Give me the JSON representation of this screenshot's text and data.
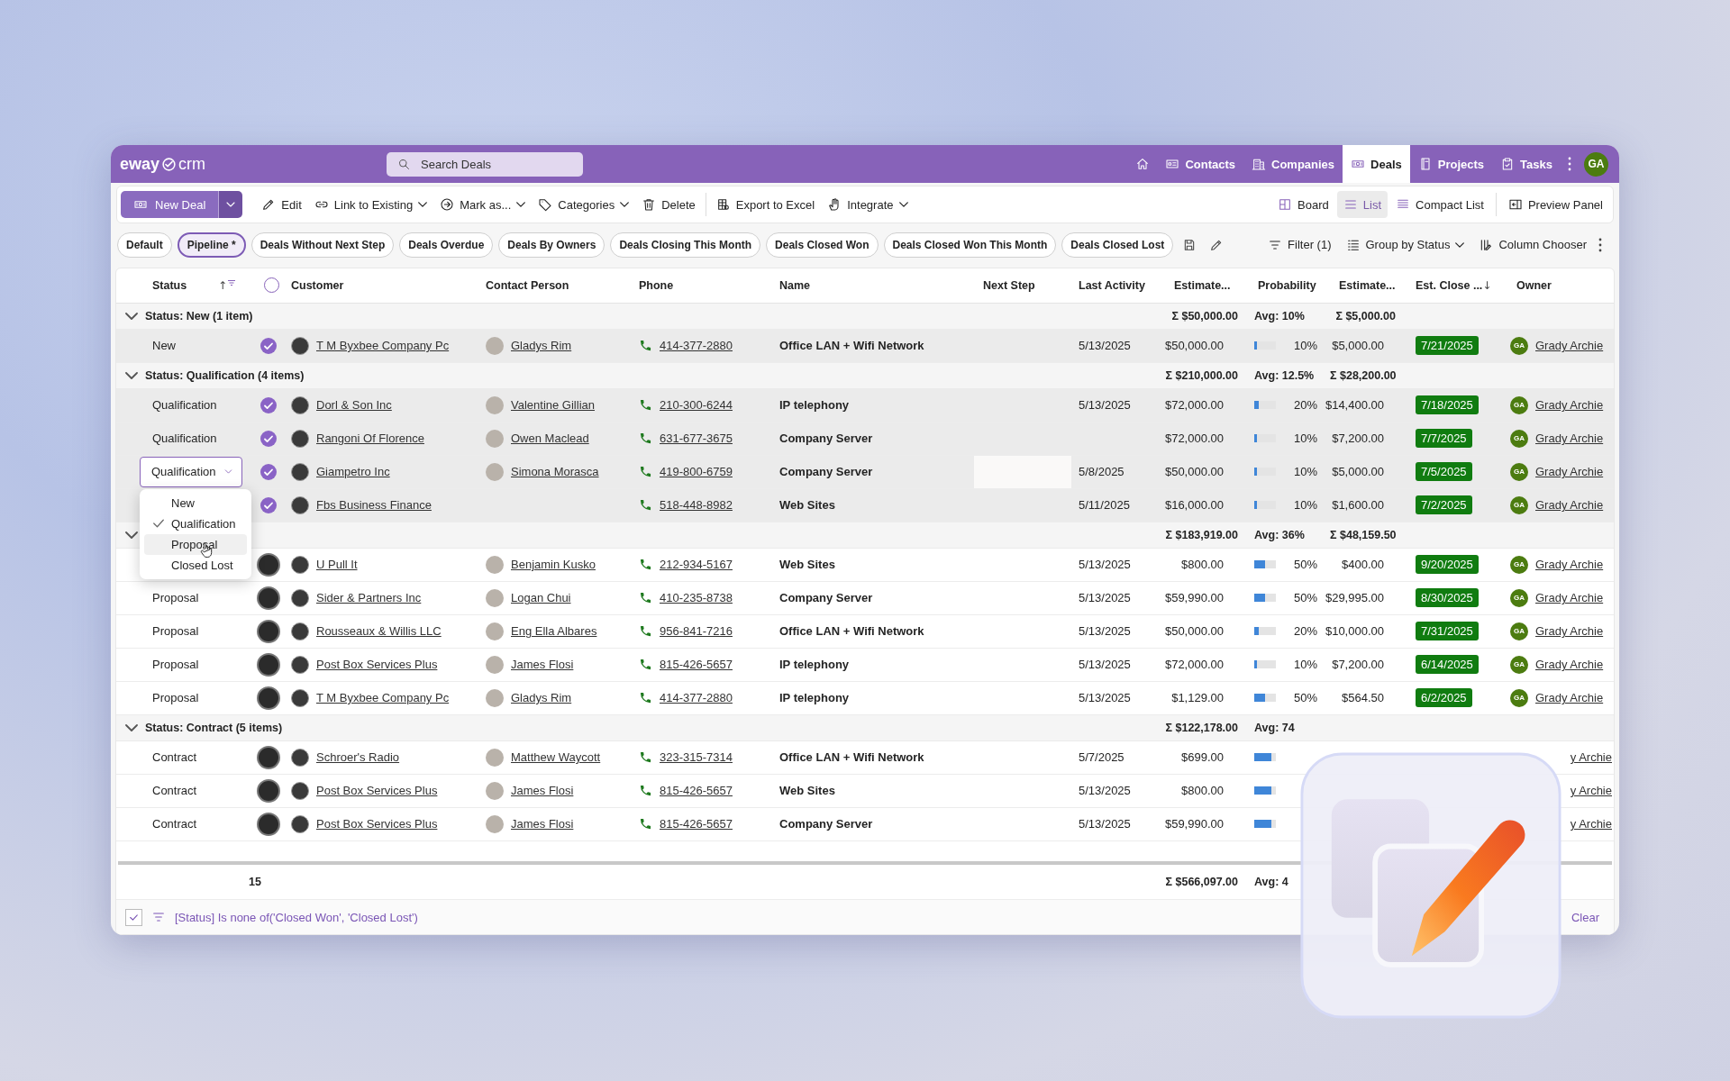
{
  "app_bar": {
    "logo_left": "eway",
    "logo_right": "crm",
    "search": {
      "placeholder": "Search Deals"
    },
    "nav": [
      {
        "label": "Contacts",
        "selected": false
      },
      {
        "label": "Companies",
        "selected": false
      },
      {
        "label": "Deals",
        "selected": true
      },
      {
        "label": "Projects",
        "selected": false
      },
      {
        "label": "Tasks",
        "selected": false
      }
    ],
    "avatar": "GA"
  },
  "toolbar": {
    "primary": "New Deal",
    "actions": [
      {
        "label": "Edit",
        "dropdown": false
      },
      {
        "label": "Link to Existing",
        "dropdown": true
      },
      {
        "label": "Mark as...",
        "dropdown": true
      },
      {
        "label": "Categories",
        "dropdown": true
      },
      {
        "label": "Delete",
        "dropdown": false
      },
      {
        "label": "Export to Excel",
        "dropdown": false
      },
      {
        "label": "Integrate",
        "dropdown": true
      }
    ],
    "views": [
      {
        "label": "Board",
        "selected": false
      },
      {
        "label": "List",
        "selected": true
      },
      {
        "label": "Compact List",
        "selected": false
      }
    ],
    "panel": "Preview Panel"
  },
  "saved_views": {
    "chips": [
      {
        "label": "Default",
        "selected": false
      },
      {
        "label": "Pipeline *",
        "selected": true
      },
      {
        "label": "Deals Without Next Step",
        "selected": false
      },
      {
        "label": "Deals Overdue",
        "selected": false
      },
      {
        "label": "Deals By Owners",
        "selected": false
      },
      {
        "label": "Deals Closing This Month",
        "selected": false
      },
      {
        "label": "Deals Closed Won",
        "selected": false
      },
      {
        "label": "Deals Closed Won This Month",
        "selected": false
      },
      {
        "label": "Deals Closed Lost",
        "selected": false
      }
    ],
    "tools": [
      {
        "label": "Filter (1)",
        "dropdown": false
      },
      {
        "label": "Group by Status",
        "dropdown": true
      },
      {
        "label": "Column Chooser",
        "dropdown": false
      }
    ]
  },
  "table": {
    "columns": [
      {
        "label": "Status",
        "sort_arrow": "↑",
        "filtered": true
      },
      {
        "kind": "select",
        "checked": false
      },
      {
        "label": "Customer"
      },
      {
        "label": "Contact Person"
      },
      {
        "label": "Phone"
      },
      {
        "label": "Name"
      },
      {
        "label": "Next Step"
      },
      {
        "label": "Last Activity"
      },
      {
        "label": "Estimate..."
      },
      {
        "label": "Probability"
      },
      {
        "label": "Estimate..."
      },
      {
        "label": "Est. Close ...",
        "sort_arrow": "↓"
      },
      {
        "label": "Owner"
      }
    ],
    "rows": [
      {
        "kind": "group",
        "expanded": true,
        "label": "Status: New (1 item)",
        "total": "Σ $50,000.00",
        "avg": "Avg: 10%",
        "total_2": "Σ $5,000.00"
      },
      {
        "kind": "deal",
        "selected": true,
        "status": "New",
        "customer": "T M Byxbee Company Pc",
        "contact": "Gladys Rim",
        "phone": "414-377-2880",
        "name": "Office LAN + Wifi Network",
        "last_activity": "5/13/2025",
        "estimate": "$50,000.00",
        "level": 0.1,
        "probability": "10%",
        "estimate_2": "$5,000.00",
        "close_date": "7/21/2025",
        "owner": {
          "initials": "GA",
          "name": "Grady Archie"
        }
      },
      {
        "kind": "group",
        "expanded": true,
        "label": "Status: Qualification (4 items)",
        "total": "Σ $210,000.00",
        "avg": "Avg: 12.5%",
        "total_2": "Σ $28,200.00"
      },
      {
        "kind": "deal",
        "selected": true,
        "status": "Qualification",
        "customer": "Dorl & Son Inc",
        "contact": "Valentine Gillian",
        "phone": "210-300-6244",
        "name": "IP telephony",
        "last_activity": "5/13/2025",
        "estimate": "$72,000.00",
        "level": 0.2,
        "probability": "20%",
        "estimate_2": "$14,400.00",
        "close_date": "7/18/2025",
        "owner": {
          "initials": "GA",
          "name": "Grady Archie"
        }
      },
      {
        "kind": "deal",
        "selected": true,
        "status": "Qualification",
        "customer": "Rangoni Of Florence",
        "contact": "Owen Maclead",
        "phone": "631-677-3675",
        "name": "Company Server",
        "estimate": "$72,000.00",
        "level": 0.1,
        "probability": "10%",
        "estimate_2": "$7,200.00",
        "close_date": "7/7/2025",
        "owner": {
          "initials": "GA",
          "name": "Grady Archie"
        }
      },
      {
        "kind": "deal",
        "selected": true,
        "editor": {
          "value": "Qualification",
          "options": [
            {
              "label": "New",
              "selected": false,
              "hovered": false
            },
            {
              "label": "Qualification",
              "selected": true,
              "hovered": false
            },
            {
              "label": "Proposal",
              "selected": false,
              "hovered": true
            },
            {
              "label": "Closed Lost",
              "selected": false,
              "hovered": false
            }
          ]
        },
        "customer": "Giampetro Inc",
        "contact": "Simona Morasca",
        "phone": "419-800-6759",
        "name": "Company Server",
        "next_step_field": true,
        "last_activity": "5/8/2025",
        "estimate": "$50,000.00",
        "level": 0.1,
        "probability": "10%",
        "estimate_2": "$5,000.00",
        "close_date": "7/5/2025",
        "owner": {
          "initials": "GA",
          "name": "Grady Archie"
        }
      },
      {
        "kind": "deal",
        "selected": true,
        "customer": "Fbs Business Finance",
        "phone": "518-448-8982",
        "name": "Web Sites",
        "last_activity": "5/11/2025",
        "estimate": "$16,000.00",
        "level": 0.1,
        "probability": "10%",
        "estimate_2": "$1,600.00",
        "close_date": "7/2/2025",
        "owner": {
          "initials": "GA",
          "name": "Grady Archie"
        }
      },
      {
        "kind": "group",
        "expanded": true,
        "total": "Σ $183,919.00",
        "avg": "Avg: 36%",
        "total_2": "Σ $48,159.50"
      },
      {
        "kind": "deal",
        "selected": false,
        "customer": "U Pull It",
        "contact": "Benjamin Kusko",
        "phone": "212-934-5167",
        "name": "Web Sites",
        "last_activity": "5/13/2025",
        "estimate": "$800.00",
        "level": 0.5,
        "probability": "50%",
        "estimate_2": "$400.00",
        "close_date": "9/20/2025",
        "owner": {
          "initials": "GA",
          "name": "Grady Archie"
        }
      },
      {
        "kind": "deal",
        "selected": false,
        "status": "Proposal",
        "customer": "Sider & Partners Inc",
        "contact": "Logan Chui",
        "phone": "410-235-8738",
        "name": "Company Server",
        "last_activity": "5/13/2025",
        "estimate": "$59,990.00",
        "level": 0.5,
        "probability": "50%",
        "estimate_2": "$29,995.00",
        "close_date": "8/30/2025",
        "owner": {
          "initials": "GA",
          "name": "Grady Archie"
        }
      },
      {
        "kind": "deal",
        "selected": false,
        "status": "Proposal",
        "customer": "Rousseaux & Willis LLC",
        "contact": "Eng Ella Albares",
        "phone": "956-841-7216",
        "name": "Office LAN + Wifi Network",
        "last_activity": "5/13/2025",
        "estimate": "$50,000.00",
        "level": 0.2,
        "probability": "20%",
        "estimate_2": "$10,000.00",
        "close_date": "7/31/2025",
        "owner": {
          "initials": "GA",
          "name": "Grady Archie"
        }
      },
      {
        "kind": "deal",
        "selected": false,
        "status": "Proposal",
        "customer": "Post Box Services Plus",
        "contact": "James Flosi",
        "phone": "815-426-5657",
        "name": "IP telephony",
        "last_activity": "5/13/2025",
        "estimate": "$72,000.00",
        "level": 0.1,
        "probability": "10%",
        "estimate_2": "$7,200.00",
        "close_date": "6/14/2025",
        "owner": {
          "initials": "GA",
          "name": "Grady Archie"
        }
      },
      {
        "kind": "deal",
        "selected": false,
        "status": "Proposal",
        "customer": "T M Byxbee Company Pc",
        "contact": "Gladys Rim",
        "phone": "414-377-2880",
        "name": "IP telephony",
        "last_activity": "5/13/2025",
        "estimate": "$1,129.00",
        "level": 0.5,
        "probability": "50%",
        "estimate_2": "$564.50",
        "close_date": "6/2/2025",
        "owner": {
          "initials": "GA",
          "name": "Grady Archie"
        }
      },
      {
        "kind": "group",
        "expanded": true,
        "label": "Status: Contract (5 items)",
        "total": "Σ $122,178.00",
        "avg": "Avg: 74"
      },
      {
        "kind": "deal",
        "selected": false,
        "status": "Contract",
        "customer": "Schroer's Radio",
        "contact": "Matthew Waycott",
        "phone": "323-315-7314",
        "name": "Office LAN + Wifi Network",
        "last_activity": "5/7/2025",
        "estimate": "$699.00",
        "level": 0.8,
        "owner": {
          "name": "y Archie"
        }
      },
      {
        "kind": "deal",
        "selected": false,
        "status": "Contract",
        "customer": "Post Box Services Plus",
        "contact": "James Flosi",
        "phone": "815-426-5657",
        "name": "Web Sites",
        "last_activity": "5/13/2025",
        "estimate": "$800.00",
        "level": 0.8,
        "owner": {
          "name": "y Archie"
        }
      },
      {
        "kind": "deal",
        "selected": false,
        "status": "Contract",
        "customer": "Post Box Services Plus",
        "contact": "James Flosi",
        "phone": "815-426-5657",
        "name": "Company Server",
        "last_activity": "5/13/2025",
        "estimate": "$59,990.00",
        "level": 0.8,
        "owner": {
          "name": "y Archie"
        }
      }
    ],
    "footer": {
      "count": "15",
      "total": "Σ $566,097.00",
      "avg": "Avg: 4"
    }
  },
  "filter_bar": {
    "enabled": true,
    "text": "[Status] Is none of('Closed Won', 'Closed Lost')",
    "clear": "Clear"
  }
}
